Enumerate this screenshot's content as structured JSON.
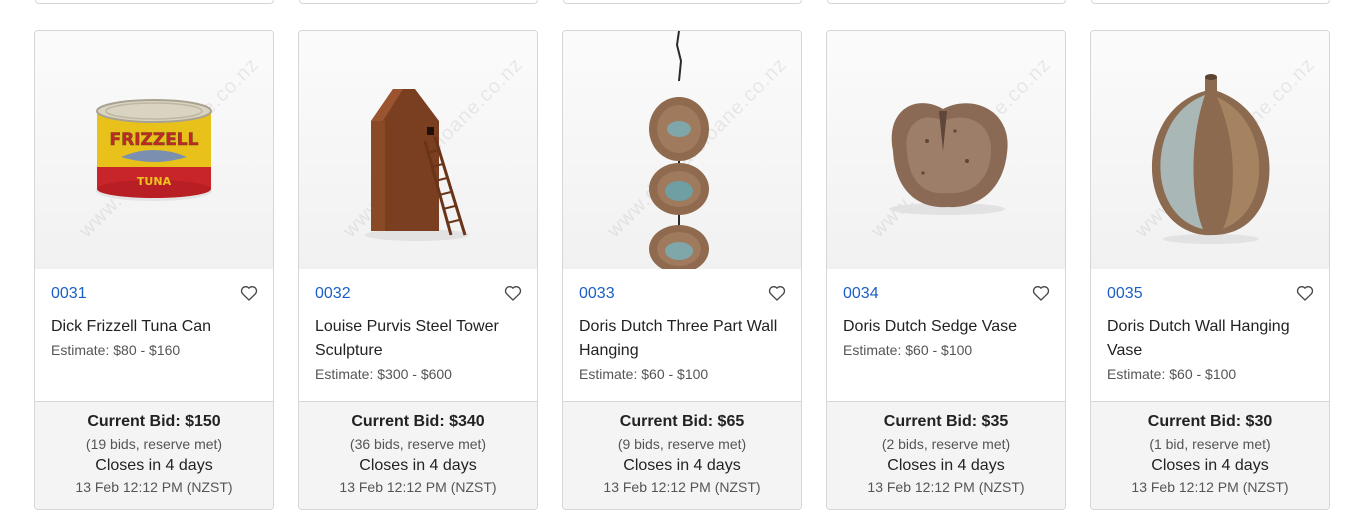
{
  "watermark_text": "www.dunbarsloane.co.nz",
  "colors": {
    "lot_link": "#1a5fc7",
    "panel_bg": "#f4f4f4",
    "border": "#d6d6d6"
  },
  "lots": [
    {
      "lot_number": "0031",
      "title": "Dick Frizzell Tuna Can",
      "estimate": "Estimate: $80 - $160",
      "current_bid": "Current Bid: $150",
      "bid_meta": "(19 bids, reserve met)",
      "closes": "Closes in 4 days",
      "close_time": "13 Feb 12:12 PM (NZST)",
      "image_icon": "tuna-can"
    },
    {
      "lot_number": "0032",
      "title": "Louise Purvis Steel Tower Sculpture",
      "estimate": "Estimate: $300 - $600",
      "current_bid": "Current Bid: $340",
      "bid_meta": "(36 bids, reserve met)",
      "closes": "Closes in 4 days",
      "close_time": "13 Feb 12:12 PM (NZST)",
      "image_icon": "steel-tower"
    },
    {
      "lot_number": "0033",
      "title": "Doris Dutch Three Part Wall Hanging",
      "estimate": "Estimate: $60 - $100",
      "current_bid": "Current Bid: $65",
      "bid_meta": "(9 bids, reserve met)",
      "closes": "Closes in 4 days",
      "close_time": "13 Feb 12:12 PM (NZST)",
      "image_icon": "wall-hanging"
    },
    {
      "lot_number": "0034",
      "title": "Doris Dutch Sedge Vase",
      "estimate": "Estimate: $60 - $100",
      "current_bid": "Current Bid: $35",
      "bid_meta": "(2 bids, reserve met)",
      "closes": "Closes in 4 days",
      "close_time": "13 Feb 12:12 PM (NZST)",
      "image_icon": "sedge-vase"
    },
    {
      "lot_number": "0035",
      "title": "Doris Dutch Wall Hanging Vase",
      "estimate": "Estimate: $60 - $100",
      "current_bid": "Current Bid: $30",
      "bid_meta": "(1 bid, reserve met)",
      "closes": "Closes in 4 days",
      "close_time": "13 Feb 12:12 PM (NZST)",
      "image_icon": "hanging-vase"
    }
  ]
}
